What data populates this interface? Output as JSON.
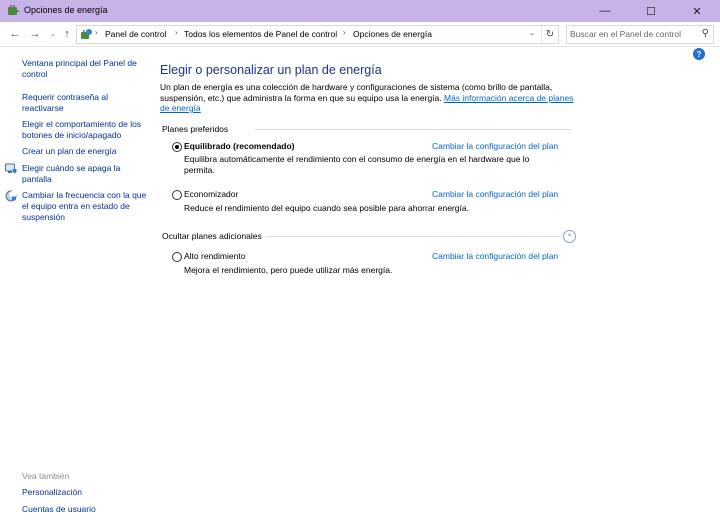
{
  "window": {
    "title": "Opciones de energía",
    "minimize_glyph": "—",
    "maximize_glyph": "☐",
    "close_glyph": "✕"
  },
  "navigation": {
    "back_glyph": "←",
    "forward_glyph": "→",
    "recent_glyph": "⌄",
    "up_glyph": "↑",
    "refresh_glyph": "↻",
    "dropdown_glyph": "⌄"
  },
  "breadcrumbs": [
    "Panel de control",
    "Todos los elementos de Panel de control",
    "Opciones de energía"
  ],
  "breadcrumb_separator": "›",
  "search": {
    "placeholder": "Buscar en el Panel de control",
    "icon_glyph": "⚲"
  },
  "help_glyph": "?",
  "sidebar": {
    "links": [
      "Ventana principal del Panel de control",
      "Requerir contraseña al reactivarse",
      "Elegir el comportamiento de los botones de inicio/apagado",
      "Crear un plan de energía",
      "Elegir cuándo se apaga la pantalla",
      "Cambiar la frecuencia con la que el equipo entra en estado de suspensión"
    ],
    "see_also_label": "Vea también",
    "see_also_links": [
      "Personalización",
      "Cuentas de usuario"
    ]
  },
  "main": {
    "heading": "Elegir o personalizar un plan de energía",
    "intro_text": "Un plan de energía es una colección de hardware y configuraciones de sistema (como brillo de pantalla, suspensión, etc.) que administra la forma en que su equipo usa la energía. ",
    "intro_link": "Más información acerca de planes de energía",
    "preferred_label": "Planes preferidos",
    "hidden_label": "Ocultar planes adicionales",
    "collapse_glyph": "⌃",
    "change_settings_label": "Cambiar la configuración del plan",
    "plans": [
      {
        "name": "Equilibrado (recomendado)",
        "description": "Equilibra automáticamente el rendimiento con el consumo de energía en el hardware que lo permita.",
        "selected": true
      },
      {
        "name": "Economizador",
        "description": "Reduce el rendimiento del equipo cuando sea posible para ahorrar energía.",
        "selected": false
      },
      {
        "name": "Alto rendimiento",
        "description": "Mejora el rendimiento, pero puede utilizar más energía.",
        "selected": false
      }
    ]
  },
  "colors": {
    "titlebar": "#c7b3e8",
    "heading": "#1e3287",
    "link": "#003399",
    "help": "#1e6fd6"
  }
}
